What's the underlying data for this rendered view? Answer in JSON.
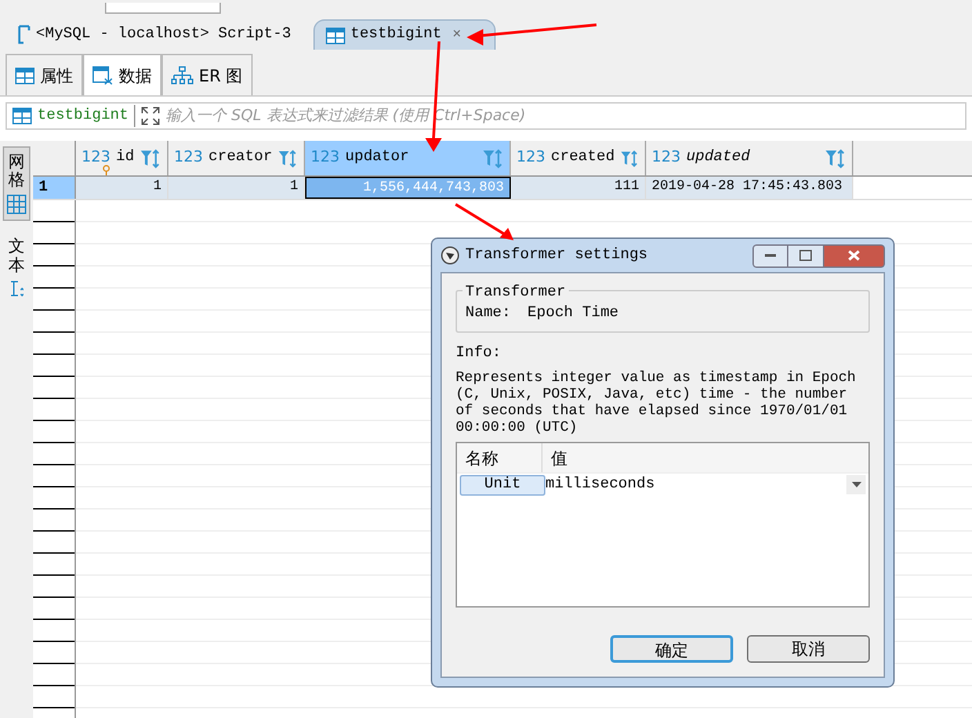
{
  "editor_tabs": [
    {
      "label": "<MySQL - localhost> Script-3",
      "selected": false
    },
    {
      "label": "testbigint",
      "selected": true
    }
  ],
  "close_glyph": "✕",
  "view_tabs": [
    {
      "label": "属性",
      "kind": "props",
      "selected": false
    },
    {
      "label": "数据",
      "kind": "data",
      "selected": true
    },
    {
      "label": "ER 图",
      "kind": "er",
      "selected": false
    }
  ],
  "filter": {
    "table": "testbigint",
    "placeholder": "输入一个 SQL 表达式来过滤结果 (使用 Ctrl+Space)"
  },
  "side_tabs": [
    {
      "label": "网格",
      "kind": "grid",
      "selected": true
    },
    {
      "label": "文本",
      "kind": "text",
      "selected": false
    }
  ],
  "table": {
    "columns": [
      {
        "type": "123",
        "name": "id",
        "italic": false,
        "selected": false,
        "key": true
      },
      {
        "type": "123",
        "name": "creator",
        "italic": false,
        "selected": false,
        "key": false
      },
      {
        "type": "123",
        "name": "updator",
        "italic": false,
        "selected": true,
        "key": false
      },
      {
        "type": "123",
        "name": "created",
        "italic": false,
        "selected": false,
        "key": false
      },
      {
        "type": "123",
        "name": "updated",
        "italic": true,
        "selected": false,
        "key": false
      }
    ],
    "rows": [
      {
        "number": "1",
        "selected": true,
        "cells": [
          "1",
          "1",
          "1,556,444,743,803",
          "111",
          "2019-04-28 17:45:43.803"
        ]
      }
    ]
  },
  "dialog": {
    "title": "Transformer settings",
    "group_title": "Transformer",
    "name_label": "Name:",
    "name_value": "Epoch Time",
    "info_label": "Info:",
    "info": "Represents integer value as timestamp in Epoch (C, Unix, POSIX, Java, etc) time - the number of seconds that have elapsed since 1970/01/01 00:00:00 (UTC)",
    "prop_columns": [
      "名称",
      "值"
    ],
    "props": [
      {
        "name": "Unit",
        "value": "milliseconds"
      }
    ],
    "buttons": [
      {
        "label": "确定",
        "default": true
      },
      {
        "label": "取消",
        "default": false
      }
    ]
  }
}
